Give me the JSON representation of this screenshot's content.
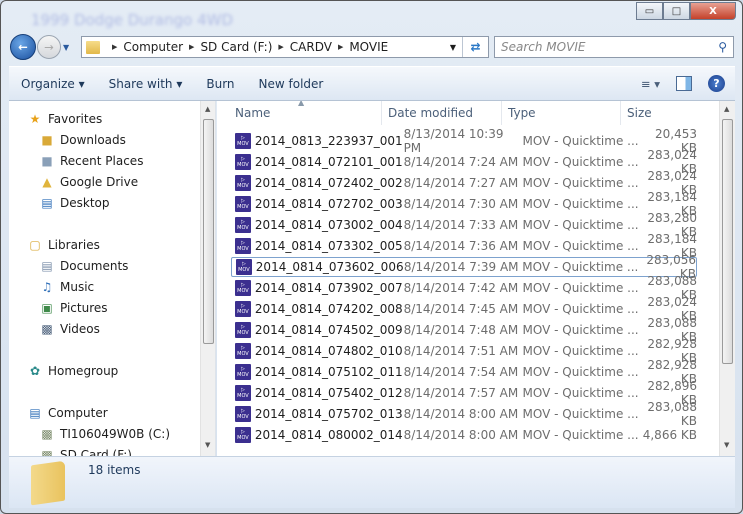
{
  "window": {
    "ghost_title": "1999 Dodge Durango 4WD",
    "minimize": "▭",
    "maximize": "□",
    "close": "X"
  },
  "address": {
    "crumbs": [
      "Computer",
      "SD Card (F:)",
      "CARDV",
      "MOVIE"
    ]
  },
  "search": {
    "placeholder": "Search MOVIE"
  },
  "toolbar": {
    "organize": "Organize ▾",
    "share": "Share with ▾",
    "burn": "Burn",
    "new_folder": "New folder"
  },
  "sidebar": {
    "favorites": "Favorites",
    "fav_items": [
      "Downloads",
      "Recent Places",
      "Google Drive",
      "Desktop"
    ],
    "libraries": "Libraries",
    "lib_items": [
      "Documents",
      "Music",
      "Pictures",
      "Videos"
    ],
    "homegroup": "Homegroup",
    "computer": "Computer",
    "drives": [
      "TI106049W0B (C:)",
      "SD Card (F:)"
    ]
  },
  "columns": {
    "name": "Name",
    "date": "Date modified",
    "type": "Type",
    "size": "Size"
  },
  "files": [
    {
      "name": "2014_0813_223937_001",
      "date": "8/13/2014 10:39 PM",
      "type": "MOV - Quicktime ...",
      "size": "20,453 KB"
    },
    {
      "name": "2014_0814_072101_001",
      "date": "8/14/2014 7:24 AM",
      "type": "MOV - Quicktime ...",
      "size": "283,024 KB"
    },
    {
      "name": "2014_0814_072402_002",
      "date": "8/14/2014 7:27 AM",
      "type": "MOV - Quicktime ...",
      "size": "283,024 KB"
    },
    {
      "name": "2014_0814_072702_003",
      "date": "8/14/2014 7:30 AM",
      "type": "MOV - Quicktime ...",
      "size": "283,184 KB"
    },
    {
      "name": "2014_0814_073002_004",
      "date": "8/14/2014 7:33 AM",
      "type": "MOV - Quicktime ...",
      "size": "283,280 KB"
    },
    {
      "name": "2014_0814_073302_005",
      "date": "8/14/2014 7:36 AM",
      "type": "MOV - Quicktime ...",
      "size": "283,184 KB"
    },
    {
      "name": "2014_0814_073602_006",
      "date": "8/14/2014 7:39 AM",
      "type": "MOV - Quicktime ...",
      "size": "283,056 KB"
    },
    {
      "name": "2014_0814_073902_007",
      "date": "8/14/2014 7:42 AM",
      "type": "MOV - Quicktime ...",
      "size": "283,088 KB"
    },
    {
      "name": "2014_0814_074202_008",
      "date": "8/14/2014 7:45 AM",
      "type": "MOV - Quicktime ...",
      "size": "283,024 KB"
    },
    {
      "name": "2014_0814_074502_009",
      "date": "8/14/2014 7:48 AM",
      "type": "MOV - Quicktime ...",
      "size": "283,088 KB"
    },
    {
      "name": "2014_0814_074802_010",
      "date": "8/14/2014 7:51 AM",
      "type": "MOV - Quicktime ...",
      "size": "282,928 KB"
    },
    {
      "name": "2014_0814_075102_011",
      "date": "8/14/2014 7:54 AM",
      "type": "MOV - Quicktime ...",
      "size": "282,928 KB"
    },
    {
      "name": "2014_0814_075402_012",
      "date": "8/14/2014 7:57 AM",
      "type": "MOV - Quicktime ...",
      "size": "282,896 KB"
    },
    {
      "name": "2014_0814_075702_013",
      "date": "8/14/2014 8:00 AM",
      "type": "MOV - Quicktime ...",
      "size": "283,088 KB"
    },
    {
      "name": "2014_0814_080002_014",
      "date": "8/14/2014 8:00 AM",
      "type": "MOV - Quicktime ...",
      "size": "4,866 KB"
    }
  ],
  "status": {
    "count": "18 items"
  }
}
